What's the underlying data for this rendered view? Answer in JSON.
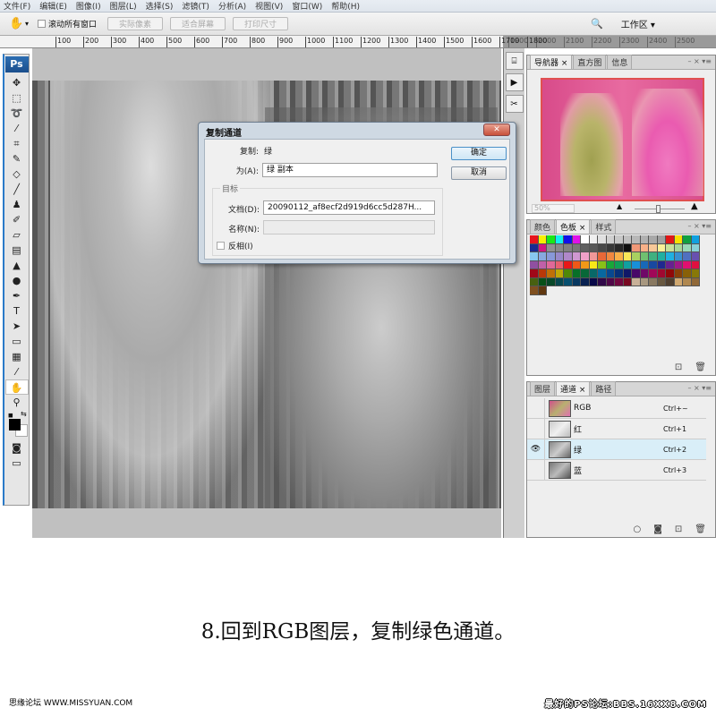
{
  "menubar": [
    "文件(F)",
    "编辑(E)",
    "图像(I)",
    "图层(L)",
    "选择(S)",
    "滤镜(T)",
    "分析(A)",
    "视图(V)",
    "窗口(W)",
    "帮助(H)"
  ],
  "options": {
    "scroll_all_label": "滚动所有窗口",
    "actual_pixels": "实际像素",
    "fit_screen": "适合屏幕",
    "print_size": "打印尺寸",
    "workspace": "工作区 ▾"
  },
  "ruler_ticks": [
    "100",
    "200",
    "300",
    "400",
    "500",
    "600",
    "700",
    "800",
    "900",
    "1000",
    "1100",
    "1200",
    "1300",
    "1400",
    "1500",
    "1600",
    "1700",
    "1800"
  ],
  "ruler_ticks_dark": [
    "1900",
    "2000",
    "2100",
    "2200",
    "2300",
    "2400",
    "2500"
  ],
  "toolbox": {
    "logo": "Ps",
    "tools": [
      {
        "name": "move-tool",
        "glyph": "✥"
      },
      {
        "name": "marquee-tool",
        "glyph": "⬚"
      },
      {
        "name": "lasso-tool",
        "glyph": "➰"
      },
      {
        "name": "magic-wand-tool",
        "glyph": "⁄"
      },
      {
        "name": "crop-tool",
        "glyph": "⌗"
      },
      {
        "name": "slice-tool",
        "glyph": "✎"
      },
      {
        "name": "healing-brush-tool",
        "glyph": "◇"
      },
      {
        "name": "brush-tool",
        "glyph": "╱"
      },
      {
        "name": "stamp-tool",
        "glyph": "♟"
      },
      {
        "name": "history-brush-tool",
        "glyph": "✐"
      },
      {
        "name": "eraser-tool",
        "glyph": "▱"
      },
      {
        "name": "gradient-tool",
        "glyph": "▤"
      },
      {
        "name": "blur-tool",
        "glyph": "▲"
      },
      {
        "name": "dodge-tool",
        "glyph": "●"
      },
      {
        "name": "pen-tool",
        "glyph": "✒"
      },
      {
        "name": "type-tool",
        "glyph": "T"
      },
      {
        "name": "path-selection-tool",
        "glyph": "➤"
      },
      {
        "name": "shape-tool",
        "glyph": "▭"
      },
      {
        "name": "notes-tool",
        "glyph": "▦"
      },
      {
        "name": "eyedropper-tool",
        "glyph": "⁄"
      },
      {
        "name": "hand-tool",
        "glyph": "✋"
      },
      {
        "name": "zoom-tool",
        "glyph": "⚲"
      }
    ]
  },
  "navigator": {
    "tabs": [
      "导航器 ×",
      "直方图",
      "信息"
    ],
    "zoom": "50%"
  },
  "swatches": {
    "tabs": [
      "颜色",
      "色板 ×",
      "样式"
    ],
    "colors": [
      "#e8141c",
      "#f8f000",
      "#18e818",
      "#10f0f0",
      "#1010e8",
      "#e010e8",
      "#ffffff",
      "#f0f0f0",
      "#e0e0e0",
      "#d0d0d0",
      "#c8c8c8",
      "#c0c0c0",
      "#b8b8b8",
      "#b0b0b0",
      "#a8a8a8",
      "#a0a0a0",
      "#e01818",
      "#f8e000",
      "#10a040",
      "#10a0e0",
      "#1a2a90",
      "#d01880",
      "#909090",
      "#888888",
      "#808080",
      "#787878",
      "#606060",
      "#585858",
      "#484848",
      "#383838",
      "#282828",
      "#101010",
      "#f09878",
      "#f8b088",
      "#f8c898",
      "#f8f098",
      "#c8e098",
      "#a8d898",
      "#98d8b8",
      "#88d0d8",
      "#88c8f0",
      "#88a8e0",
      "#8898d8",
      "#9888c8",
      "#b088c8",
      "#d098d0",
      "#f0a0c8",
      "#f09898",
      "#e86838",
      "#f08840",
      "#f8b048",
      "#f8e858",
      "#a8d060",
      "#70c070",
      "#40b080",
      "#20b0a0",
      "#20b0e0",
      "#3890d0",
      "#5070c0",
      "#6850b0",
      "#9050a0",
      "#c060a8",
      "#e06898",
      "#e86070",
      "#e81818",
      "#f05818",
      "#f09818",
      "#f8e818",
      "#88c018",
      "#18a838",
      "#10a058",
      "#10a0a0",
      "#1890d8",
      "#1868b8",
      "#1848a0",
      "#202890",
      "#682090",
      "#a01888",
      "#e01070",
      "#e01040",
      "#a00818",
      "#b83808",
      "#c07008",
      "#c0a808",
      "#508808",
      "#087028",
      "#086838",
      "#086868",
      "#0868a0",
      "#084890",
      "#083078",
      "#101868",
      "#480868",
      "#700868",
      "#a00858",
      "#a00830",
      "#900808",
      "#884008",
      "#886008",
      "#887808",
      "#486010",
      "#085018",
      "#084828",
      "#084850",
      "#085070",
      "#083860",
      "#082050",
      "#080848",
      "#300848",
      "#500848",
      "#700840",
      "#780820",
      "#c8b098",
      "#a89880",
      "#887860",
      "#685840",
      "#504030",
      "#d0a870",
      "#b08850",
      "#906838",
      "#805020",
      "#603810"
    ]
  },
  "channels": {
    "tabs": [
      "图层",
      "通道 ×",
      "路径"
    ],
    "rows": [
      {
        "name": "RGB",
        "shortcut": "Ctrl+~",
        "visible": false,
        "active": false
      },
      {
        "name": "红",
        "shortcut": "Ctrl+1",
        "visible": false,
        "active": false
      },
      {
        "name": "绿",
        "shortcut": "Ctrl+2",
        "visible": true,
        "active": true
      },
      {
        "name": "蓝",
        "shortcut": "Ctrl+3",
        "visible": false,
        "active": false
      }
    ]
  },
  "dialog": {
    "title": "复制通道",
    "close": "✕",
    "source_label": "复制:",
    "source_value": "绿",
    "as_label": "为(A):",
    "as_value": "绿 副本",
    "group_label": "目标",
    "doc_label": "文档(D):",
    "doc_value": "20090112_af8ecf2d919d6cc5d287H...",
    "name_label": "名称(N):",
    "name_value": "",
    "invert_label": "反相(I)",
    "ok": "确定",
    "cancel": "取消"
  },
  "caption": "8.回到RGB图层，复制绿色通道。",
  "footer": {
    "left": "思缘论坛  WWW.MISSYUAN.COM",
    "right": "最好的PS论坛:BBS.16XX8.COM"
  }
}
